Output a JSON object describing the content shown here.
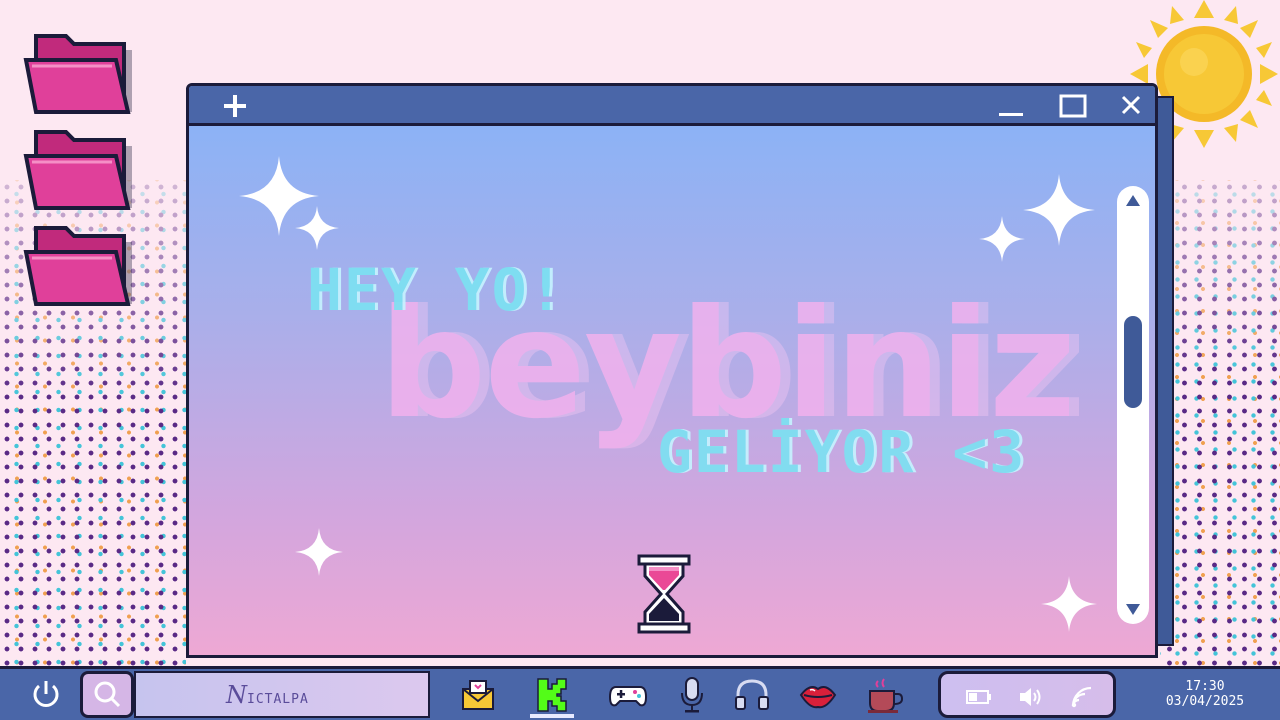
{
  "desktop": {
    "folders": [
      {
        "icon": "folder-icon"
      },
      {
        "icon": "folder-icon"
      },
      {
        "icon": "folder-icon"
      }
    ],
    "decorations": [
      "sun-icon",
      "dot-pattern"
    ]
  },
  "window": {
    "titlebar": {
      "new_tab_icon": "plus-icon",
      "minimize_icon": "minimize-icon",
      "maximize_icon": "maximize-icon",
      "close_icon": "close-icon"
    },
    "content": {
      "line1": "HEY YO!",
      "script_text": "beybiniz",
      "line2": "GELİYOR <3",
      "loading_icon": "hourglass-icon"
    },
    "scrollbar": {
      "position_fraction": 0.35
    }
  },
  "taskbar": {
    "power_icon": "power-icon",
    "search_icon": "search-icon",
    "brand": {
      "initial": "N",
      "rest": "ICTALPA"
    },
    "apps": [
      {
        "name": "mail",
        "icon": "mail-icon"
      },
      {
        "name": "kick",
        "icon": "kick-logo-icon",
        "active": true
      },
      {
        "name": "games",
        "icon": "gamepad-icon"
      },
      {
        "name": "microphone",
        "icon": "microphone-icon"
      },
      {
        "name": "headphones",
        "icon": "headphones-icon"
      },
      {
        "name": "lips",
        "icon": "lips-icon"
      },
      {
        "name": "coffee",
        "icon": "coffee-cup-icon"
      }
    ],
    "tray": {
      "battery_icon": "battery-icon",
      "volume_icon": "volume-icon",
      "wifi_icon": "wifi-icon"
    },
    "clock": {
      "time": "17:30",
      "date": "03/04/2025"
    }
  },
  "colors": {
    "titlebar": "#4a66a8",
    "outline": "#1b1b3a",
    "folder": "#e0409a",
    "text_cyan": "#7be2f2",
    "script_pink": "#f4b2ee",
    "gradient_top": "#86b3f8",
    "gradient_bottom": "#eea8d4"
  }
}
